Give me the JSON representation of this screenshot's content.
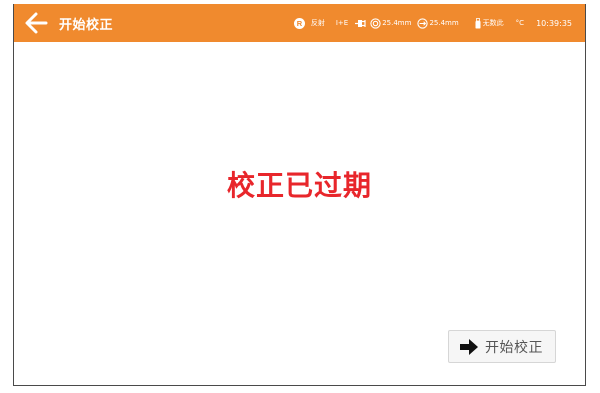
{
  "header": {
    "title": "开始校正",
    "background_color": "#f08a2e",
    "back_icon": "arrow-left-icon"
  },
  "status_bar": {
    "mode_badge": "R",
    "mode_label": "反射",
    "signal_label": "I+E",
    "aperture_value": "25.4mm",
    "distance_value": "25.4mm",
    "data_label": "无数此",
    "temperature_unit": "°C",
    "time": "10:39:35"
  },
  "main": {
    "message": "校正已过期",
    "message_color": "#e8262b",
    "start_button_label": "开始校正",
    "start_button_icon": "arrow-right-icon"
  }
}
